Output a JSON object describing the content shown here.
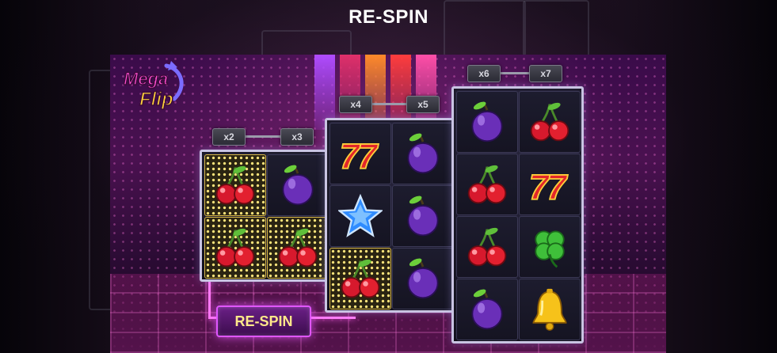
{
  "header": {
    "title": "RE-SPIN"
  },
  "logo": {
    "line1": "Mega",
    "line2": "Flip"
  },
  "reels": [
    {
      "multipliers": [
        "x2",
        "x3"
      ],
      "cells": [
        [
          {
            "symbol": "cherry",
            "highlight": true
          },
          {
            "symbol": "plum",
            "highlight": false
          }
        ],
        [
          {
            "symbol": "cherry",
            "highlight": true
          },
          {
            "symbol": "cherry",
            "highlight": true
          }
        ]
      ]
    },
    {
      "multipliers": [
        "x4",
        "x5"
      ],
      "cells": [
        [
          {
            "symbol": "seven",
            "highlight": false
          },
          {
            "symbol": "plum",
            "highlight": false
          }
        ],
        [
          {
            "symbol": "star",
            "highlight": false
          },
          {
            "symbol": "plum",
            "highlight": false
          }
        ],
        [
          {
            "symbol": "cherry",
            "highlight": true
          },
          {
            "symbol": "plum",
            "highlight": false
          }
        ]
      ]
    },
    {
      "multipliers": [
        "x6",
        "x7"
      ],
      "cells": [
        [
          {
            "symbol": "plum",
            "highlight": false
          },
          {
            "symbol": "cherry",
            "highlight": false
          }
        ],
        [
          {
            "symbol": "cherry",
            "highlight": false
          },
          {
            "symbol": "seven",
            "highlight": false
          }
        ],
        [
          {
            "symbol": "cherry",
            "highlight": false
          },
          {
            "symbol": "clover",
            "highlight": false
          }
        ],
        [
          {
            "symbol": "plum",
            "highlight": false
          },
          {
            "symbol": "bell",
            "highlight": false
          }
        ]
      ]
    }
  ],
  "respin_button": {
    "label": "RE-SPIN"
  },
  "colors": {
    "accent": "#ff7bf7",
    "button_text": "#ffe88a",
    "frame": "#c9c4e3"
  }
}
